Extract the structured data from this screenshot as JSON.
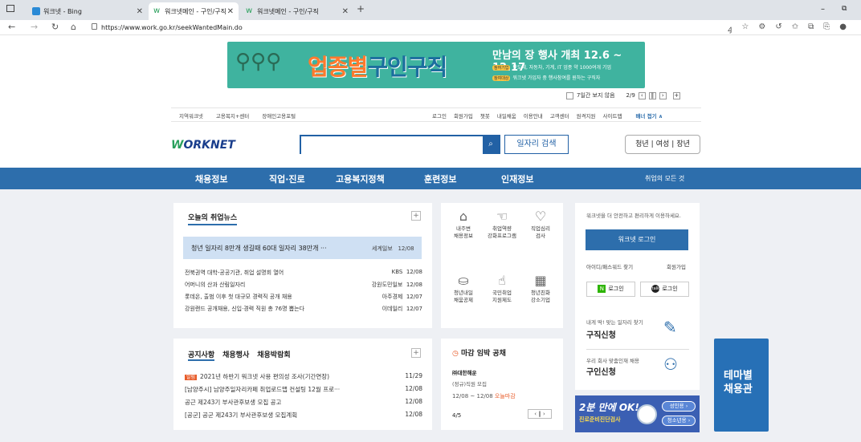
{
  "browser": {
    "tabs": [
      {
        "title": "워크넷 - Bing"
      },
      {
        "title": "워크넷메인 - 구인/구직"
      },
      {
        "title": "워크넷메인 - 구인/구직"
      }
    ],
    "new_tab": "+",
    "url": "https://www.work.go.kr/seekWantedMain.do",
    "minimize": "–",
    "restore": "⧉"
  },
  "banner": {
    "headline_part1": "업종별",
    "headline_part2": "구인구직",
    "title": "만남의 장 행사 개최 12.6 ~ 12.17",
    "badge1": "참여기업",
    "line1": "반도체, 자동차, 기계, IT 업종 약 1000여개 기업",
    "badge2": "참여대상",
    "line2": "워크넷 가입자 중 행사참여를 원하는 구직자",
    "hide_label": "7일간 보지 않음",
    "pager": "2/9"
  },
  "util": {
    "left": [
      "지역워크넷",
      "고용복지+센터",
      "장애인고용포털"
    ],
    "right": [
      "로그인",
      "회원가입",
      "챗봇",
      "내일채움",
      "이용안내",
      "고객센터",
      "원격지원",
      "사이트맵"
    ],
    "fold": "배너 접기 ∧"
  },
  "header": {
    "logo_w": "W",
    "logo_rest": "ORKNET",
    "search_btn": "일자리 검색",
    "ages": [
      "청년",
      "여성",
      "장년"
    ]
  },
  "gnb": {
    "items": [
      "채용정보",
      "직업·진로",
      "고용복지정책",
      "훈련정보",
      "인재정보"
    ],
    "all": "취업의 모든 것"
  },
  "news": {
    "title": "오늘의 취업뉴스",
    "headline": {
      "text": "청년 일자리 8만개 생길때 60대 일자리 38만개 ···",
      "source": "세계일보",
      "date": "12/08"
    },
    "items": [
      {
        "t": "전북권역 대학-공공기관, 취업 설명회 열어",
        "s": "KBS",
        "d": "12/08"
      },
      {
        "t": "어머니의 산과 산림일자리",
        "s": "강원도민일보",
        "d": "12/08"
      },
      {
        "t": "롯데온, 출범 이후 첫 대규모 경력직 공개 채용",
        "s": "아주경제",
        "d": "12/07"
      },
      {
        "t": "강원랜드 공개채용, 신입·경력 직원 총 76명 뽑는다",
        "s": "이데일리",
        "d": "12/07"
      }
    ]
  },
  "services": [
    {
      "l1": "내주변",
      "l2": "채용정보"
    },
    {
      "l1": "취업역량",
      "l2": "강화프로그램"
    },
    {
      "l1": "직업심리",
      "l2": "검사"
    },
    {
      "l1": "청년내일",
      "l2": "채움공제"
    },
    {
      "l1": "국민취업",
      "l2": "지원제도"
    },
    {
      "l1": "청년친화",
      "l2": "강소기업"
    }
  ],
  "login": {
    "intro": "워크넷을 더 안전하고 편리하게 이용하세요.",
    "btn": "워크넷 로그인",
    "find": "아이디/패스워드 찾기",
    "join": "회원가입",
    "naver": "로그인",
    "kakao": "로그인"
  },
  "jobcards": [
    {
      "sub": "내게 딱! 맞는 일자리 찾기",
      "title": "구직신청"
    },
    {
      "sub": "우리 회사 맞춤인재 채용",
      "title": "구인신청"
    }
  ],
  "notice": {
    "tabs": [
      "공지사항",
      "채용행사",
      "채용박람회"
    ],
    "items": [
      {
        "tag": "알림",
        "t": "2021년 하반기 워크넷 사용 편의성 조사(기간연장)",
        "d": "11/29"
      },
      {
        "t": "[남양주시] 남양주일자리카페 취업로드맵 컨설팅 12월 프로···",
        "d": "12/08"
      },
      {
        "t": "공근 제243기 부사관후보생 모집 공고",
        "d": "12/08"
      },
      {
        "t": "[공군] 공군 제243기 부사관후보생 모집계획",
        "d": "12/08"
      }
    ]
  },
  "deadline": {
    "title": "마감 임박 공채",
    "company": "㈜대한해운",
    "company2": "(정규)직원 모집",
    "range": "12/08 ~ 12/08",
    "today": "오늘마감",
    "page": "4/5"
  },
  "ok_banner": {
    "l1": "2분 만에 OK!",
    "l2": "진로준비진단검사",
    "p1": "성인용 ›",
    "p2": "청소년용 ›"
  },
  "theme": {
    "l1": "테마별",
    "l2": "채용관"
  }
}
